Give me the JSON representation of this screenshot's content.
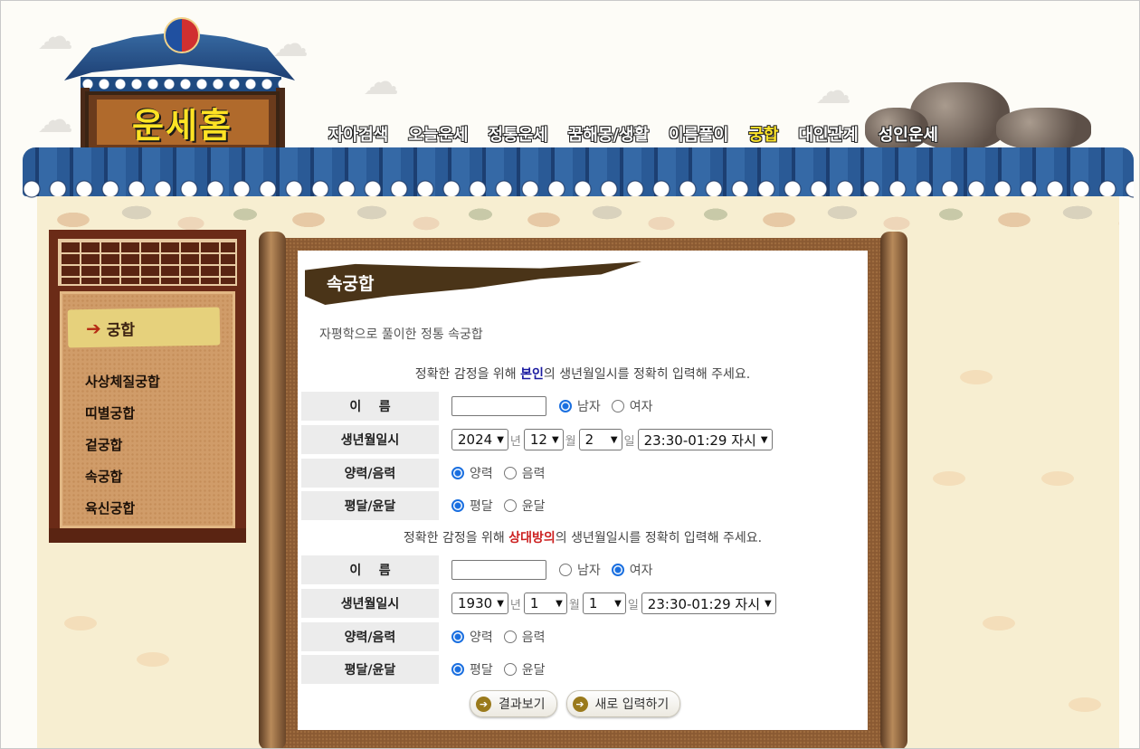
{
  "logo": {
    "text": "운세홈"
  },
  "nav": {
    "items": [
      {
        "label": "자아검색"
      },
      {
        "label": "오늘운세"
      },
      {
        "label": "정통운세"
      },
      {
        "label": "꿈해몽/생활"
      },
      {
        "label": "이름풀이"
      },
      {
        "label": "궁합",
        "active": true
      },
      {
        "label": "대인관계"
      },
      {
        "label": "성인운세"
      }
    ],
    "active_color": "#ffe629"
  },
  "sidebar": {
    "header": "궁합",
    "items": [
      {
        "label": "사상체질궁합"
      },
      {
        "label": "띠별궁합"
      },
      {
        "label": "겉궁합"
      },
      {
        "label": "속궁합",
        "active": true
      },
      {
        "label": "육신궁합"
      }
    ]
  },
  "content": {
    "title": "속궁합",
    "subtitle": "자평학으로 풀이한 정통 속궁합",
    "self_notice": {
      "pre": "정확한 감정을 위해 ",
      "em": "본인",
      "post": "의 생년월일시를 정확히 입력해 주세요."
    },
    "partner_notice": {
      "pre": "정확한 감정을 위해 ",
      "em": "상대방의",
      "post": "의 생년월일시를 정확히 입력해 주세요."
    },
    "labels": {
      "name": "이    름",
      "birth": "생년월일시",
      "calendar": "양력/음력",
      "leap": "평달/윤달"
    },
    "units": {
      "year": "년",
      "month": "월",
      "day": "일"
    },
    "options": {
      "male": "남자",
      "female": "여자",
      "solar": "양력",
      "lunar": "음력",
      "normal": "평달",
      "leap": "윤달"
    },
    "self": {
      "name": "",
      "gender": "male",
      "year": "2024",
      "month": "12",
      "day": "2",
      "hour": "23:30-01:29 자시",
      "calendar": "solar",
      "leap": "normal"
    },
    "partner": {
      "name": "",
      "gender": "female",
      "year": "1930",
      "month": "1",
      "day": "1",
      "hour": "23:30-01:29 자시",
      "calendar": "solar",
      "leap": "normal"
    },
    "buttons": {
      "result": "결과보기",
      "reset": "새로 입력하기"
    }
  }
}
